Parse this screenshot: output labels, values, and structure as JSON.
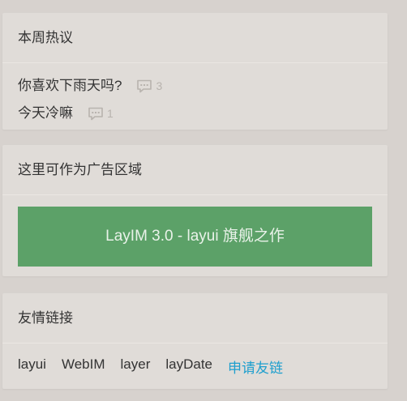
{
  "hot": {
    "title": "本周热议",
    "items": [
      {
        "title": "你喜欢下雨天吗?",
        "comments": "3"
      },
      {
        "title": "今天冷嘛",
        "comments": "1"
      }
    ]
  },
  "ad": {
    "title": "这里可作为广告区域",
    "banner": "LayIM 3.0 - layui 旗舰之作",
    "banner_color": "#5ca168"
  },
  "links": {
    "title": "友情链接",
    "items": [
      "layui",
      "WebIM",
      "layer",
      "layDate"
    ],
    "apply": "申请友链",
    "apply_color": "#1e9fce"
  }
}
